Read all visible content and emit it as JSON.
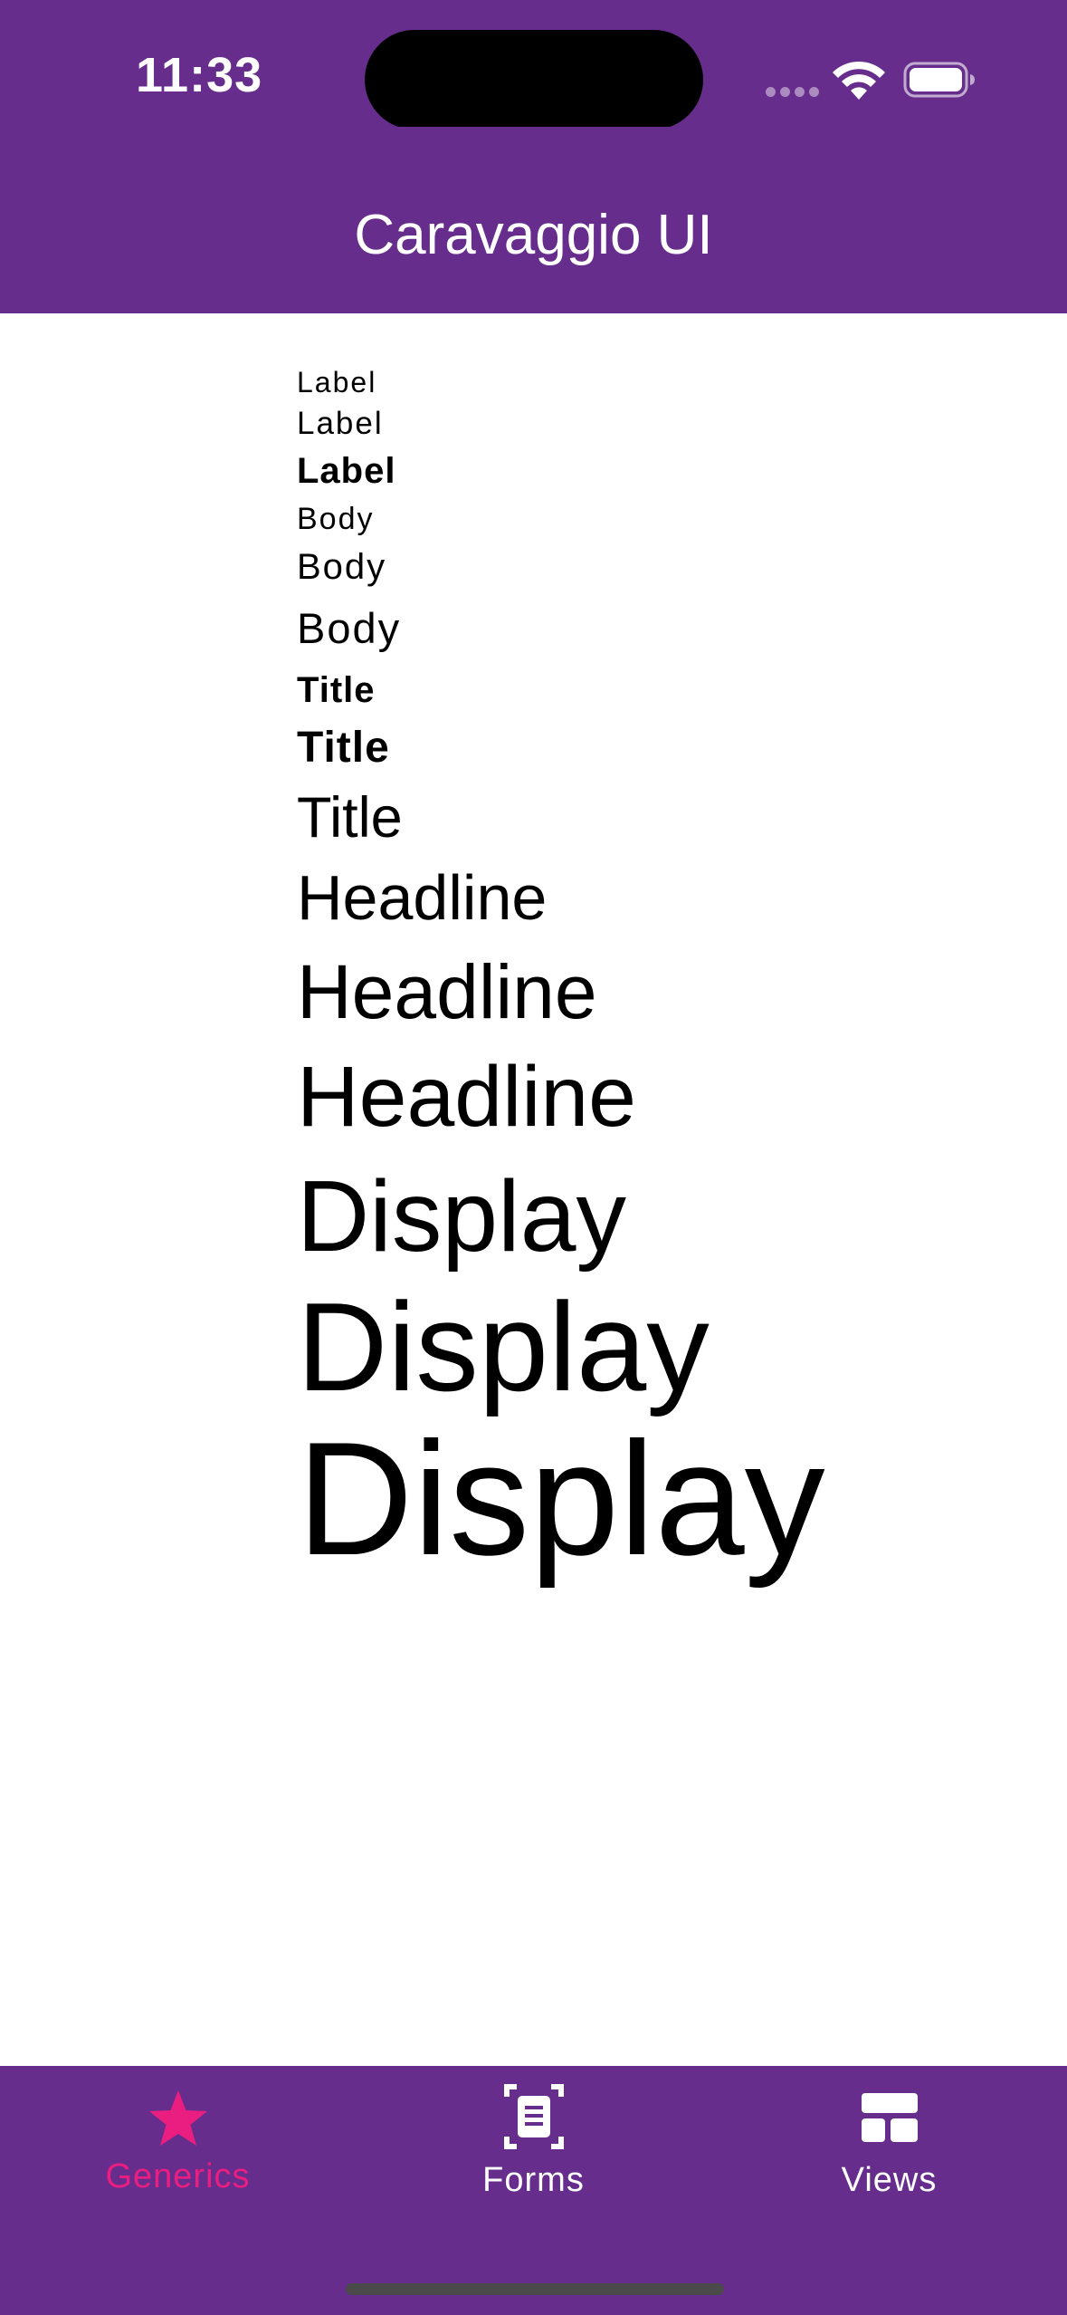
{
  "status_bar": {
    "time": "11:33",
    "background_color": "#662d8c"
  },
  "header": {
    "title": "Caravaggio UI",
    "background_color": "#662d8c"
  },
  "typography": {
    "label_small": "Label",
    "label_medium": "Label",
    "label_large": "Label",
    "body_small": "Body",
    "body_medium": "Body",
    "body_large": "Body",
    "title_small": "Title",
    "title_medium": "Title",
    "title_large": "Title",
    "headline_small": "Headline",
    "headline_medium": "Headline",
    "headline_large": "Headline",
    "display_small": "Display",
    "display_medium": "Display",
    "display_large": "Display"
  },
  "tab_bar": {
    "background_color": "#662d8c",
    "active_color": "#e91e80",
    "tabs": [
      {
        "label": "Generics",
        "icon": "star-icon",
        "active": true
      },
      {
        "label": "Forms",
        "icon": "document-scan-icon",
        "active": false
      },
      {
        "label": "Views",
        "icon": "dashboard-icon",
        "active": false
      }
    ]
  }
}
